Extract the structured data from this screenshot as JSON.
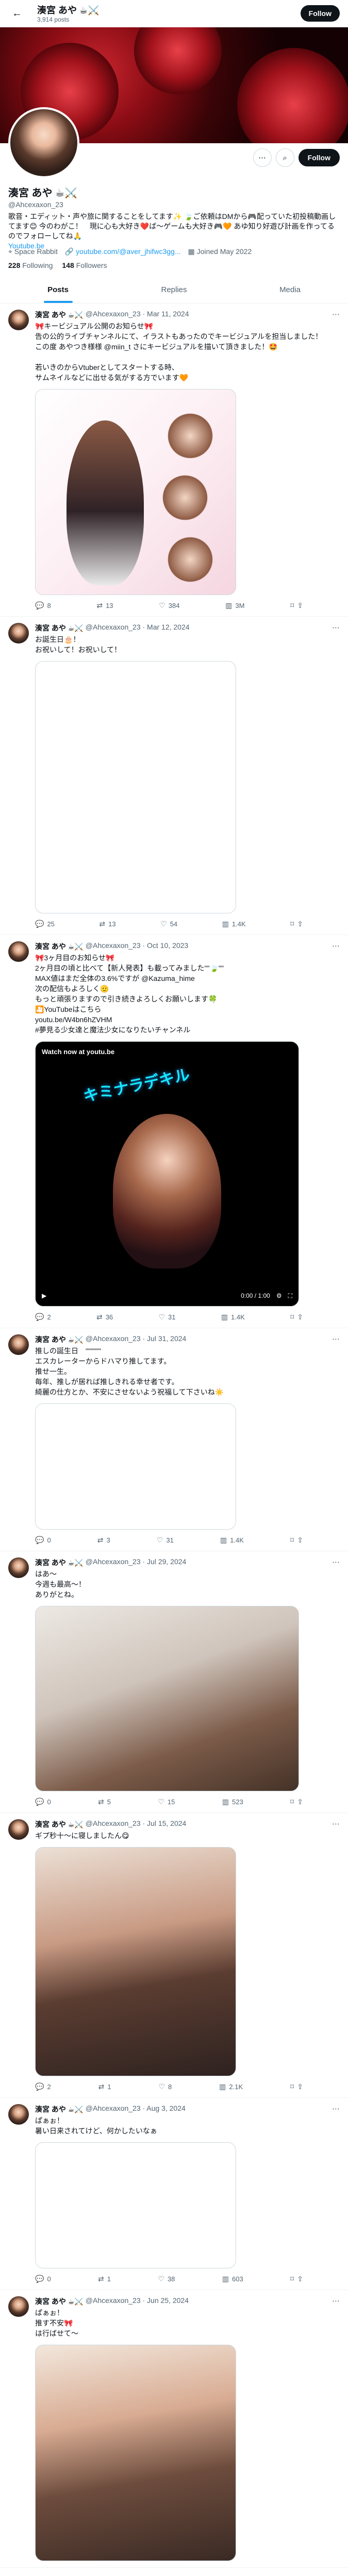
{
  "header": {
    "name": "湊宮 あや ☕⚔️",
    "count": "3,914 posts",
    "follow": "Follow"
  },
  "profile": {
    "name": "湊宮 あや ☕⚔️",
    "handle": "@Ahcexaxon_23",
    "follow": "Follow",
    "bio": "歌音・エディット・声や旅に関することをしてます✨ 🍃ご依頼はDMから🎮配っていた初投稿動画してます😊 今のわがこ！　現に心も大好き❤️ば〜ゲームも大好き🎮🧡 あゆ知り好遊び計画を作ってるのでフォローしてね🙏",
    "link": "Youtube.be",
    "location": "Space Rabbit",
    "website": "youtube.com/@aver_jhifwc3gg...",
    "joined": "Joined May 2022",
    "following": "228",
    "following_label": "Following",
    "followers": "148",
    "followers_label": "Followers"
  },
  "tabs": [
    "Posts",
    "Replies",
    "Media"
  ],
  "tweets": [
    {
      "name": "湊宮 あや ☕⚔️",
      "handle": "@Ahcexaxon_23 · Mar 11, 2024",
      "text": "🎀キービジュアル公開のお知らせ🎀\n告の公的ライブチャンネルにて、イラストもあったのでキービジュアルを担当しました！\nこの度 あやつき様様 @miin_t さにキービジュアルを描いて頂きました！🤩\n\n若いきのからVtuberとしてスタートする時、\nサムネイルなどに出せる気がする方でいます🧡",
      "reply": "8",
      "rt": "13",
      "like": "384",
      "view": "3M"
    },
    {
      "name": "湊宮 あや ☕⚔️",
      "handle": "@Ahcexaxon_23 · Mar 12, 2024",
      "text": "お誕生日🎂！\nお祝いして！お祝いして！",
      "reply": "25",
      "rt": "13",
      "like": "54",
      "view": "1.4K"
    },
    {
      "name": "湊宮 あや ☕⚔️",
      "handle": "@Ahcexaxon_23 · Oct 10, 2023",
      "text": "🎀3ヶ月目のお知らせ🎀\n2ヶ月目の頃と比べて【新人発表】も載ってみました\"\"🍃\"\"\nMAX値はまだ全体の3.6%ですが @Kazuma_hime\n次の配信もよろしく🫡\nもっと頑張りますので引き続きよろしくお願いします🍀\n🎦YouTubeはこちら\nyoutu.be/W4bn6hZVHM\n#夢見る少女達と魔法少女になりたいチャンネル",
      "reply": "2",
      "rt": "36",
      "like": "31",
      "view": "1.4K",
      "video_badge": "Watch now at youtu.be",
      "video_title": "キミナラデキル",
      "video_time": "0:00 / 1:00"
    },
    {
      "name": "湊宮 あや ☕⚔️",
      "handle": "@Ahcexaxon_23 · Jul 31, 2024",
      "text": "推しの誕生日　\"\"\"\"\"\"\nエスカレーターからドハマり推してます。\n推せ一生。\n毎年、推しが居れば推しきれる幸せ者です。\n綺麗の仕方とか、不安にさせないよう祝福して下さいね☀️",
      "reply": "0",
      "rt": "3",
      "like": "31",
      "view": "1.4K"
    },
    {
      "name": "湊宮 あや ☕⚔️",
      "handle": "@Ahcexaxon_23 · Jul 29, 2024",
      "text": "はあ〜\n今週も最高〜！\nありがとね。",
      "reply": "0",
      "rt": "5",
      "like": "15",
      "view": "523"
    },
    {
      "name": "湊宮 あや ☕⚔️",
      "handle": "@Ahcexaxon_23 · Jul 15, 2024",
      "text": "ギプ秒十〜に寝しましたん😋",
      "reply": "2",
      "rt": "1",
      "like": "8",
      "view": "2.1K"
    },
    {
      "name": "湊宮 あや ☕⚔️",
      "handle": "@Ahcexaxon_23 · Aug 3, 2024",
      "text": "ぱぁぉ！\n暑い日来されてけど、何かしたいなぁ",
      "reply": "0",
      "rt": "1",
      "like": "38",
      "view": "603"
    },
    {
      "name": "湊宮 あや ☕⚔️",
      "handle": "@Ahcexaxon_23 · Jun 25, 2024",
      "text": "ぱぁぉ！\n推す不安🎀\nは行ばせて〜",
      "reply": "",
      "rt": "",
      "like": "",
      "view": ""
    }
  ],
  "icons": {
    "back": "arrow-left-icon",
    "more": "more-icon",
    "reply": "reply-icon",
    "retweet": "retweet-icon",
    "like": "heart-icon",
    "views": "chart-icon",
    "bookmark": "bookmark-icon",
    "share": "share-icon"
  },
  "colors": {
    "accent": "#1d9bf0",
    "text": "#0f1419",
    "muted": "#536471"
  }
}
